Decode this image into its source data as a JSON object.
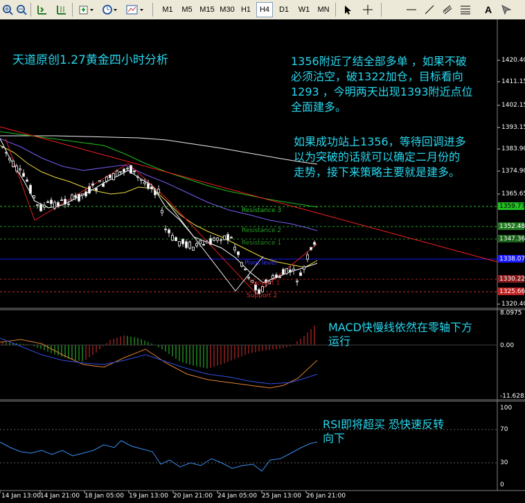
{
  "toolbar": {
    "timeframes": [
      "M1",
      "M5",
      "M15",
      "M30",
      "H1",
      "H4",
      "D1",
      "W1",
      "MN"
    ],
    "active_timeframe": "H4",
    "text_tool": "A"
  },
  "annotations": {
    "title": "天道原创1.27黄金四小时分析",
    "note1_line1": "1356附近了结全部多单 ，如果不破",
    "note1_line2": "必须沽空，破1322加仓，目标看向",
    "note1_line3": "1293 ，今明两天出现1393附近点位",
    "note1_line4": "全面建多。",
    "note2_line1": "如果成功站上1356，等待回调进多",
    "note2_line2": "以为突破的话就可以确定二月份的",
    "note2_line3": "走势，接下来策略主要就是建多。",
    "macd_line1": "MACD快慢线依然在零轴下方",
    "macd_line2": "运行",
    "rsi_line1": "RSI即将超买  恐快速反转",
    "rsi_line2": "向下"
  },
  "levels": {
    "resistance3": "Resistance 3",
    "resistance2": "Resistance 2",
    "resistance1": "Resistance 1",
    "pivot": "Pivot level",
    "support1": "Support 1",
    "support2": "Support 2"
  },
  "price_axis": [
    "1420.40",
    "1411.15",
    "1402.15",
    "1393.15",
    "1383.90",
    "1374.90",
    "1365.65",
    "1320.40"
  ],
  "price_tags": {
    "r3": "1359.77",
    "r2": "1352.48",
    "r1": "1347.36",
    "pivot": "1338.07",
    "s1": "1330.22",
    "s2": "1325.66"
  },
  "macd_axis": {
    "top": "8.0975",
    "zero": "0.00",
    "bottom": "-11.6283"
  },
  "rsi_axis": {
    "top": "100",
    "ob": "70",
    "os": "30",
    "bottom": "0"
  },
  "time_axis": [
    "14 Jan 13:00",
    "14 Jan 21:00",
    "18 Jan 05:00",
    "19 Jan 13:00",
    "20 Jan 21:00",
    "24 Jan 05:00",
    "25 Jan 13:00",
    "26 Jan 21:00"
  ],
  "colors": {
    "annotation": "#27d8ef",
    "resistance": "#22c022",
    "support": "#d03030",
    "pivot": "#1a1aff",
    "trendline": "#ff2020"
  }
}
